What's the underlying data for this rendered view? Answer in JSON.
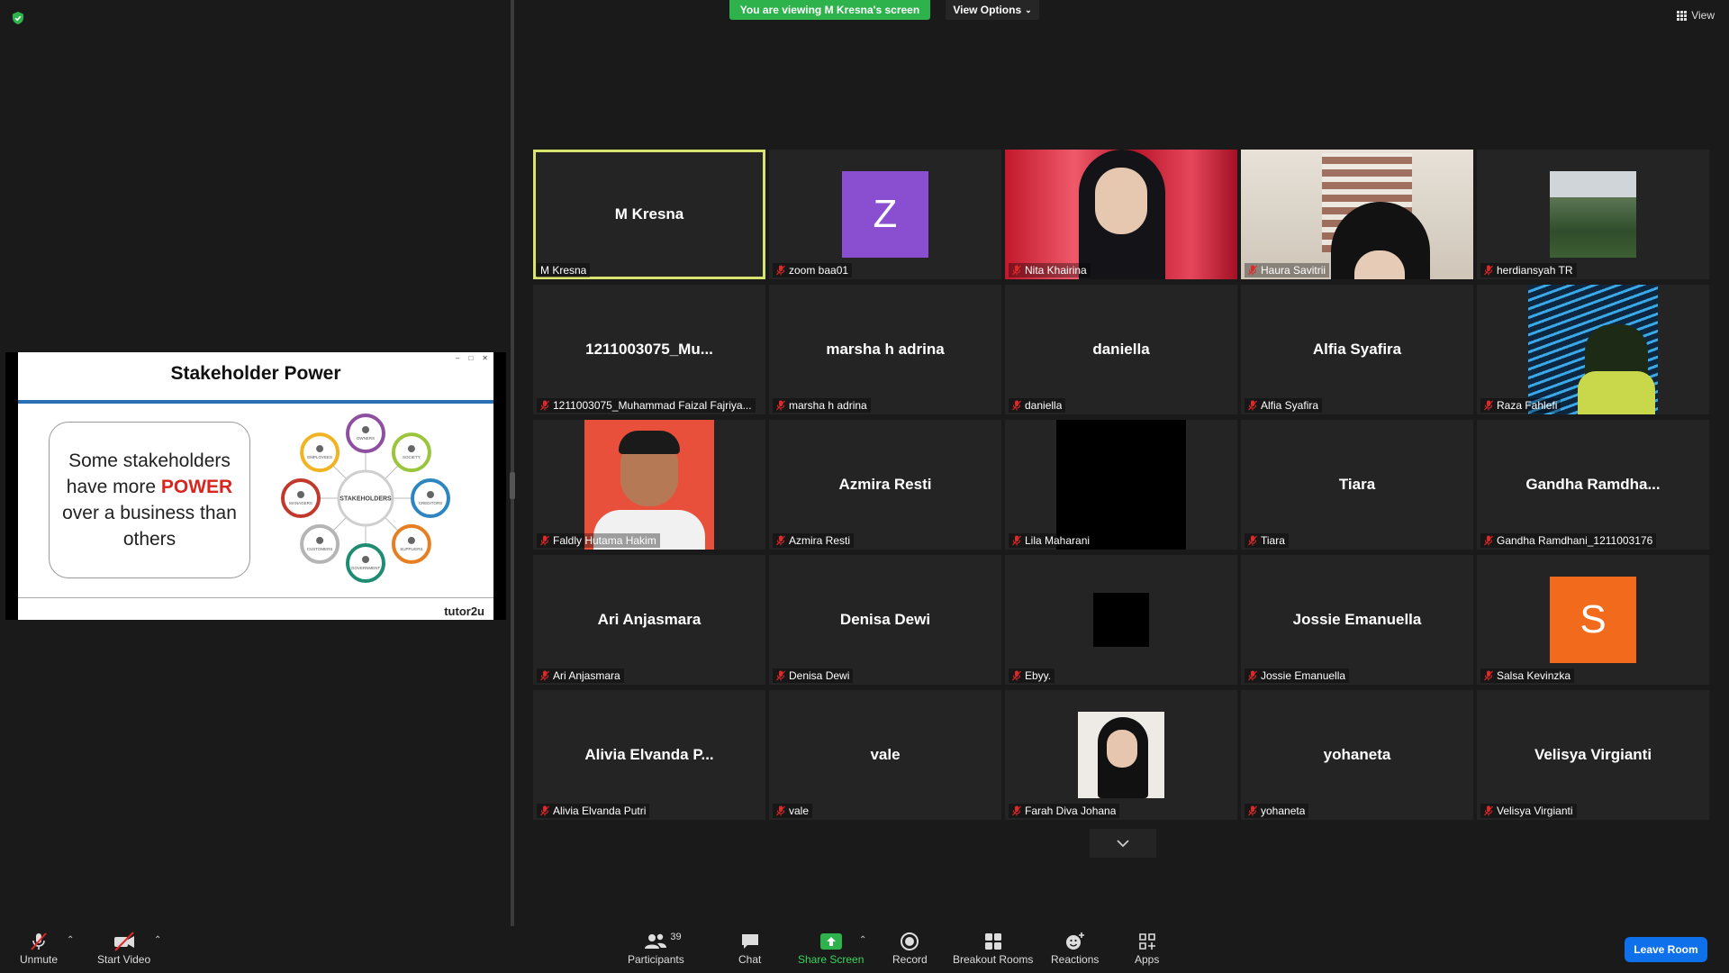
{
  "banner": {
    "viewing": "You are viewing M Kresna's screen",
    "view_options": "View Options",
    "view": "View"
  },
  "slide": {
    "title": "Stakeholder Power",
    "text_before": "Some stakeholders have more",
    "text_power": "POWER",
    "text_after": "over a business than others",
    "center": "STAKEHOLDERS",
    "nodes": [
      "OWNERS",
      "SOCIETY",
      "CREDITORS",
      "SUPPLIERS",
      "GOVERNMENT",
      "CUSTOMERS",
      "MANAGERS",
      "EMPLOYEES"
    ],
    "node_colors": [
      "#8e4fa1",
      "#9bc53d",
      "#2e86c1",
      "#e67e22",
      "#1e8c73",
      "#b5b5b5",
      "#c0392b",
      "#f0b323"
    ],
    "brand": "tutor2u"
  },
  "participants": [
    {
      "center": "M Kresna",
      "name": "M Kresna",
      "muted": false,
      "active": true
    },
    {
      "avatar": "Z",
      "avatar_color": "#8a4fd0",
      "name": "zoom baa01",
      "muted": true
    },
    {
      "photo": "nita",
      "name": "Nita Khairina",
      "muted": true
    },
    {
      "photo": "haura",
      "name": "Haura Savitrii",
      "muted": true
    },
    {
      "photo": "herdiansyah",
      "name": "herdiansyah TR",
      "muted": true
    },
    {
      "center": "1211003075_Mu...",
      "name": "1211003075_Muhammad Faizal Fajriya...",
      "muted": true
    },
    {
      "center": "marsha h adrina",
      "name": "marsha h adrina",
      "muted": true
    },
    {
      "center": "daniella",
      "name": "daniella",
      "muted": true
    },
    {
      "center": "Alfia Syafira",
      "name": "Alfia Syafira",
      "muted": true
    },
    {
      "photo": "raza",
      "name": "Raza Fahlefi",
      "muted": true
    },
    {
      "photo": "faldly",
      "name": "Faldly Hutama Hakim",
      "muted": true
    },
    {
      "center": "Azmira Resti",
      "name": "Azmira Resti",
      "muted": true
    },
    {
      "photo": "lila",
      "name": "Lila Maharani",
      "muted": true
    },
    {
      "center": "Tiara",
      "name": "Tiara",
      "muted": true
    },
    {
      "center": "Gandha Ramdha...",
      "name": "Gandha Ramdhani_1211003176",
      "muted": true
    },
    {
      "center": "Ari Anjasmara",
      "name": "Ari Anjasmara",
      "muted": true
    },
    {
      "center": "Denisa Dewi",
      "name": "Denisa Dewi",
      "muted": true
    },
    {
      "photo": "ebyy",
      "name": "Ebyy.",
      "muted": true
    },
    {
      "center": "Jossie Emanuella",
      "name": "Jossie Emanuella",
      "muted": true
    },
    {
      "avatar": "S",
      "avatar_color": "#f26b1d",
      "name": "Salsa Kevinzka",
      "muted": true
    },
    {
      "center": "Alivia Elvanda P...",
      "name": "Alivia Elvanda Putri",
      "muted": true
    },
    {
      "center": "vale",
      "name": "vale",
      "muted": true
    },
    {
      "photo": "farah",
      "name": "Farah Diva Johana",
      "muted": true
    },
    {
      "center": "yohaneta",
      "name": "yohaneta",
      "muted": true
    },
    {
      "center": "Velisya Virgianti",
      "name": "Velisya Virgianti",
      "muted": true
    }
  ],
  "toolbar": {
    "unmute": "Unmute",
    "start_video": "Start Video",
    "participants": "Participants",
    "participants_count": "39",
    "chat": "Chat",
    "share_screen": "Share Screen",
    "record": "Record",
    "breakout_rooms": "Breakout Rooms",
    "reactions": "Reactions",
    "apps": "Apps",
    "leave_room": "Leave Room"
  },
  "colors": {
    "share_green": "#2db24c",
    "active_border": "#d7e46d",
    "leave_blue": "#0e71eb",
    "muted_red": "#e02828"
  }
}
